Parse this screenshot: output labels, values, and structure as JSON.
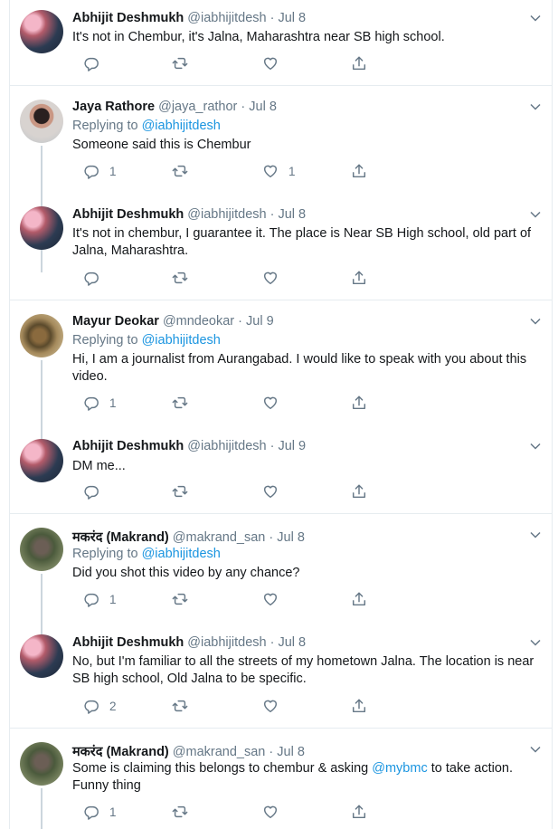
{
  "tweets": [
    {
      "author": "Abhijit Deshmukh",
      "handle": "@iabhijitdesh",
      "date": "Jul 8",
      "replying_to": null,
      "text": "It's not in Chembur, it's Jalna, Maharashtra near SB high school.",
      "text_suffix": "",
      "link_in_text": "",
      "reply_count": "",
      "retweet_count": "",
      "like_count": "",
      "avatar": "abhijit"
    },
    {
      "author": "Jaya Rathore",
      "handle": "@jaya_rathor",
      "date": "Jul 8",
      "replying_to": "@iabhijitdesh",
      "text": "Someone said this is Chembur",
      "text_suffix": "",
      "link_in_text": "",
      "reply_count": "1",
      "retweet_count": "",
      "like_count": "1",
      "avatar": "jaya"
    },
    {
      "author": "Abhijit Deshmukh",
      "handle": "@iabhijitdesh",
      "date": "Jul 8",
      "replying_to": null,
      "text": "It's not in chembur, I guarantee it. The place is Near SB High school, old part of Jalna, Maharashtra.",
      "text_suffix": "",
      "link_in_text": "",
      "reply_count": "",
      "retweet_count": "",
      "like_count": "",
      "avatar": "abhijit"
    },
    {
      "author": "Mayur Deokar",
      "handle": "@mndeokar",
      "date": "Jul 9",
      "replying_to": "@iabhijitdesh",
      "text": "Hi, I am a journalist from Aurangabad. I would like to speak with you about this video.",
      "text_suffix": "",
      "link_in_text": "",
      "reply_count": "1",
      "retweet_count": "",
      "like_count": "",
      "avatar": "mayur"
    },
    {
      "author": "Abhijit Deshmukh",
      "handle": "@iabhijitdesh",
      "date": "Jul 9",
      "replying_to": null,
      "text": "DM me...",
      "text_suffix": "",
      "link_in_text": "",
      "reply_count": "",
      "retweet_count": "",
      "like_count": "",
      "avatar": "abhijit"
    },
    {
      "author": "मकरंद (Makrand)",
      "handle": "@makrand_san",
      "date": "Jul 8",
      "replying_to": "@iabhijitdesh",
      "text": "Did you shot this video by any chance?",
      "text_suffix": "",
      "link_in_text": "",
      "reply_count": "1",
      "retweet_count": "",
      "like_count": "",
      "avatar": "makrand"
    },
    {
      "author": "Abhijit Deshmukh",
      "handle": "@iabhijitdesh",
      "date": "Jul 8",
      "replying_to": null,
      "text": "No, but I'm familiar to all the streets of my hometown Jalna. The location is near SB high school, Old Jalna to be specific.",
      "text_suffix": "",
      "link_in_text": "",
      "reply_count": "2",
      "retweet_count": "",
      "like_count": "",
      "avatar": "abhijit"
    },
    {
      "author": "मकरंद (Makrand)",
      "handle": "@makrand_san",
      "date": "Jul 8",
      "replying_to": null,
      "text": "Some is claiming this belongs to chembur & asking ",
      "link_in_text": "@mybmc",
      "text_suffix": " to take action. Funny thing",
      "reply_count": "1",
      "retweet_count": "",
      "like_count": "",
      "avatar": "makrand"
    }
  ],
  "labels": {
    "replying_prefix": "Replying to ",
    "separator": " · "
  },
  "colors": {
    "accent": "#1b95e0",
    "secondary_text": "#657786",
    "border": "#e6ecf0",
    "thread_line": "#ccd6dd"
  },
  "icons": [
    "reply-icon",
    "retweet-icon",
    "like-icon",
    "share-icon",
    "chevron-down-icon"
  ]
}
